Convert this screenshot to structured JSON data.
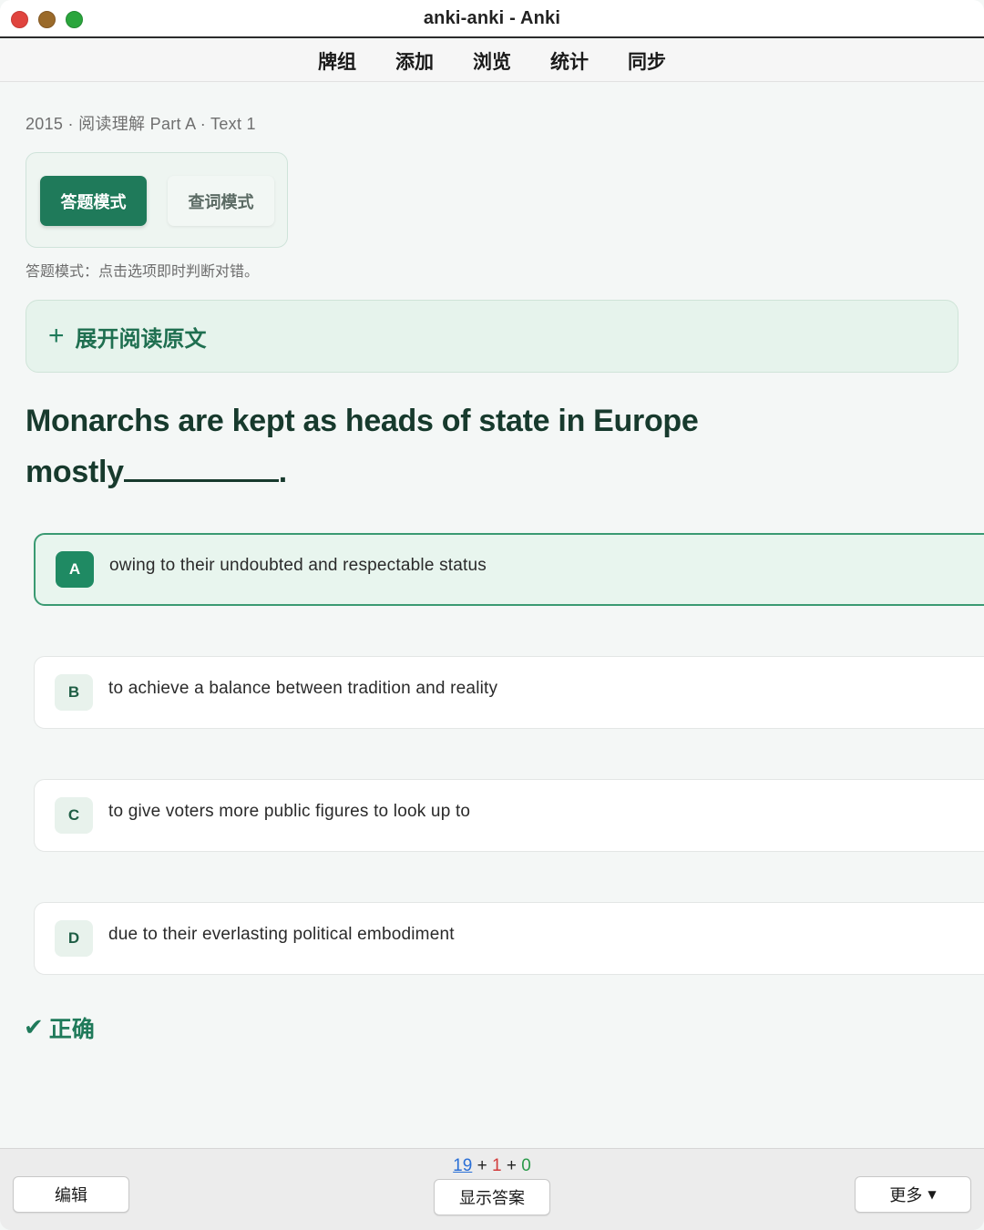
{
  "window": {
    "title": "anki-anki - Anki"
  },
  "menu": {
    "items": [
      "牌组",
      "添加",
      "浏览",
      "统计",
      "同步"
    ]
  },
  "card": {
    "breadcrumb": "2015 · 阅读理解 Part A · Text 1",
    "modes": {
      "answer_label": "答题模式",
      "lookup_label": "查词模式",
      "active": "answer"
    },
    "mode_hint": "答题模式：点击选项即时判断对错。",
    "expand": {
      "icon": "plus-icon",
      "label": "展开阅读原文"
    },
    "question": {
      "text": "Monarchs are kept as heads of state in Europe mostly",
      "end": "."
    },
    "options": [
      {
        "letter": "A",
        "text": "owing to their undoubted and respectable status",
        "selected": true
      },
      {
        "letter": "B",
        "text": "to achieve a balance between tradition and reality",
        "selected": false
      },
      {
        "letter": "C",
        "text": "to give voters more public figures to look up to",
        "selected": false
      },
      {
        "letter": "D",
        "text": "due to their everlasting political embodiment",
        "selected": false
      }
    ],
    "result": {
      "icon": "check-icon",
      "label": "正确",
      "color": "#1f7a5a"
    }
  },
  "bottom": {
    "edit_label": "编辑",
    "show_answer_label": "显示答案",
    "more_label": "更多",
    "counts": {
      "new": "19",
      "learn": "1",
      "review": "0",
      "sep": "+"
    }
  },
  "colors": {
    "accent": "#1f7a5a",
    "new": "#2a6fd6",
    "learn": "#d23b3b",
    "review": "#2a9a4a"
  }
}
